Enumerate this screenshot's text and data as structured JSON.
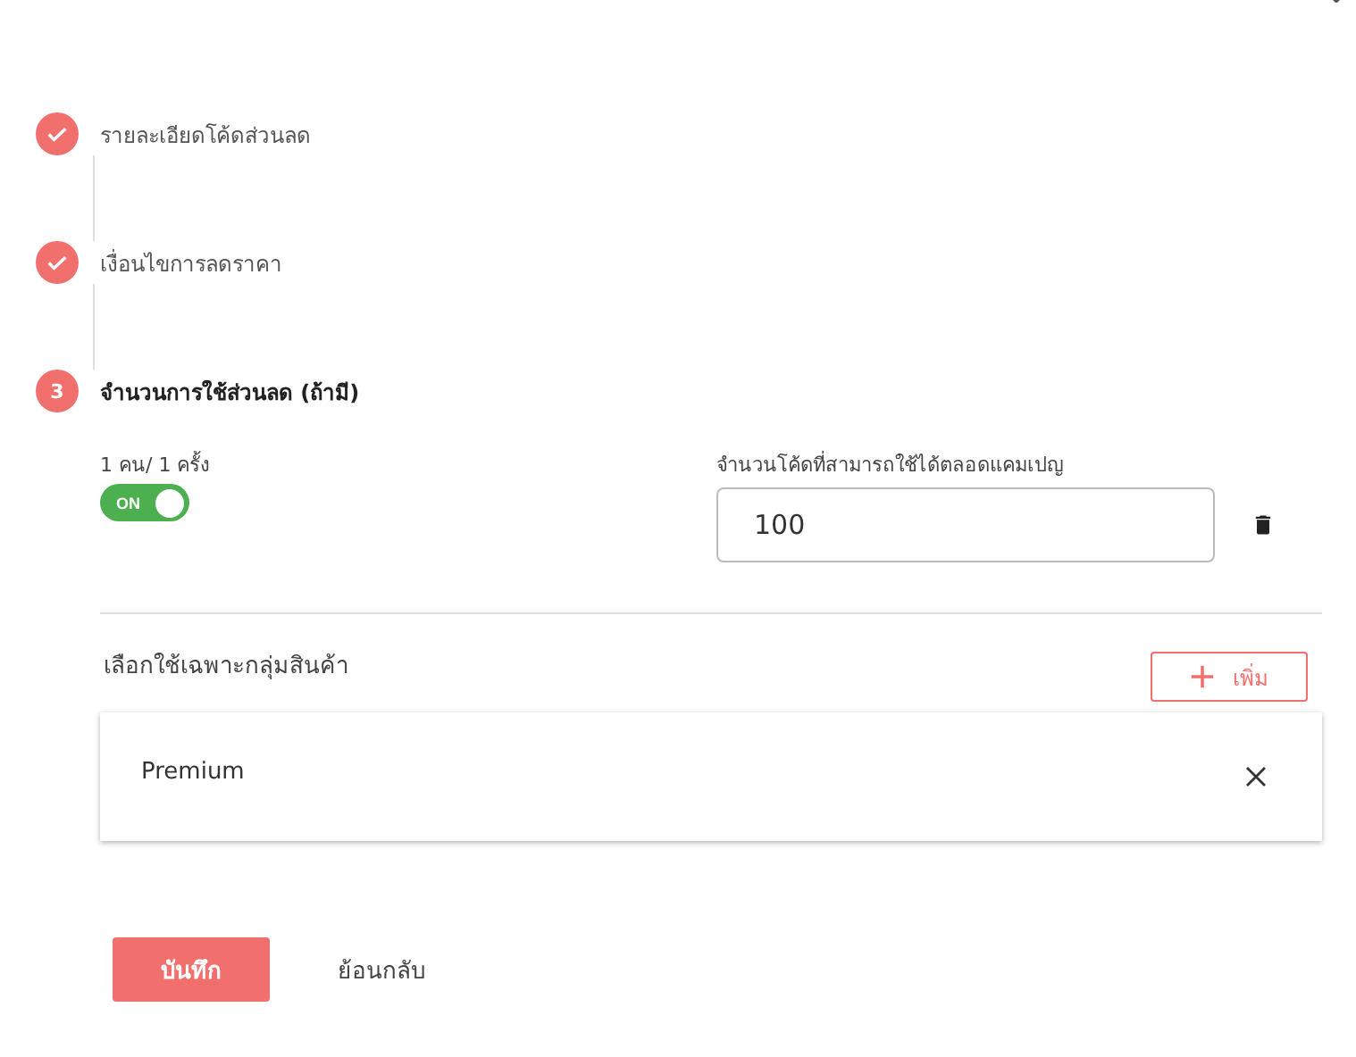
{
  "steps": [
    {
      "label": "รายละเอียดโค้ดส่วนลด",
      "kind": "done"
    },
    {
      "label": "เงื่อนไขการลดราคา",
      "kind": "done"
    },
    {
      "label": "จำนวนการใช้ส่วนลด (ถ้ามี)",
      "kind": "active",
      "number": "3"
    }
  ],
  "limit": {
    "label": "1 คน/ 1 ครั้ง",
    "toggle_text": "ON",
    "on": true
  },
  "code_count": {
    "label": "จำนวนโค้ดที่สามารถใช้ได้ตลอดแคมเปญ",
    "value": "100"
  },
  "product_groups": {
    "label": "เลือกใช้เฉพาะกลุ่มสินค้า",
    "add_button": "เพิ่ม",
    "items": [
      {
        "name": "Premium"
      }
    ]
  },
  "buttons": {
    "save": "บันทึก",
    "back": "ย้อนกลับ"
  }
}
